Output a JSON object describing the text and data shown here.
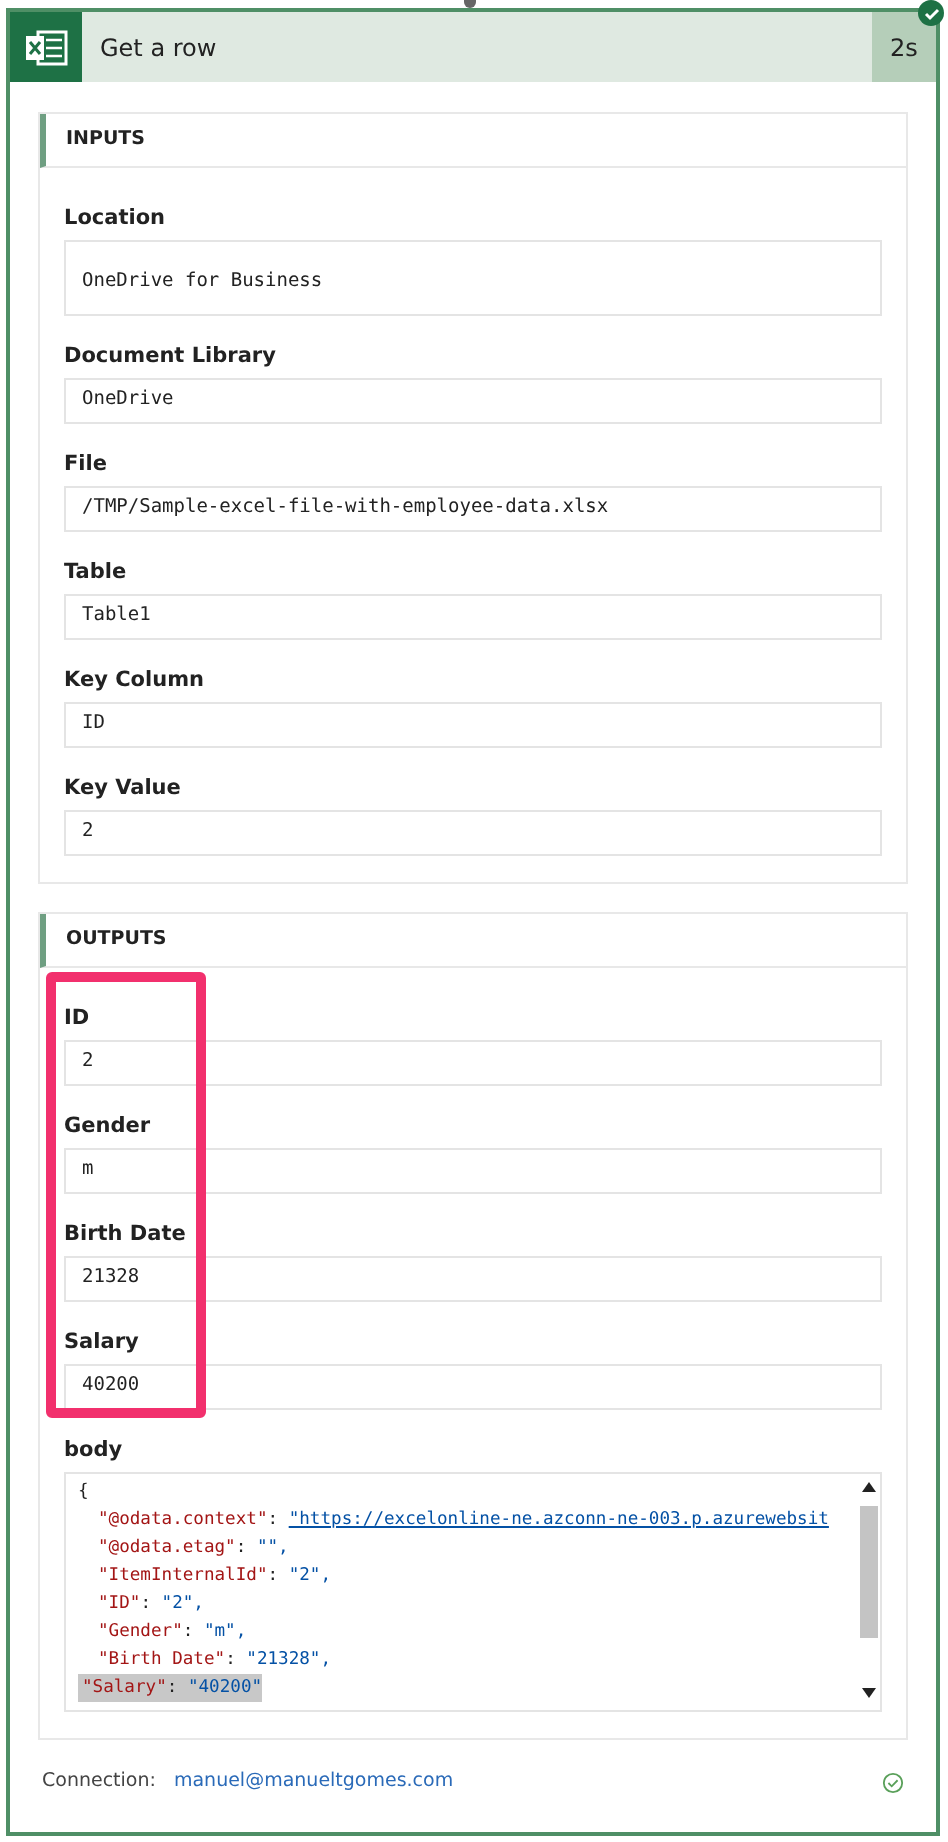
{
  "action": {
    "title": "Get a row",
    "duration": "2s",
    "succeeded": true
  },
  "inputs": {
    "title": "INPUTS",
    "fields": [
      {
        "label": "Location",
        "value": "OneDrive for Business",
        "tall": true
      },
      {
        "label": "Document Library",
        "value": "OneDrive",
        "tall": false
      },
      {
        "label": "File",
        "value": "/TMP/Sample-excel-file-with-employee-data.xlsx",
        "tall": false
      },
      {
        "label": "Table",
        "value": "Table1",
        "tall": false
      },
      {
        "label": "Key Column",
        "value": "ID",
        "tall": false
      },
      {
        "label": "Key Value",
        "value": "2",
        "tall": false
      }
    ]
  },
  "outputs": {
    "title": "OUTPUTS",
    "highlighted": true,
    "fields": [
      {
        "label": "ID",
        "value": "2"
      },
      {
        "label": "Gender",
        "value": "m"
      },
      {
        "label": "Birth Date",
        "value": "21328"
      },
      {
        "label": "Salary",
        "value": "40200"
      }
    ],
    "body": {
      "label": "body",
      "open": "{",
      "lines": [
        {
          "key": "\"@odata.context\"",
          "sep": ":",
          "value": "\"https://excelonline-ne.azconn-ne-003.p.azurewebsit",
          "link": true,
          "selected": false
        },
        {
          "key": "\"@odata.etag\"",
          "sep": ":",
          "value": "\"\",",
          "link": false,
          "selected": false
        },
        {
          "key": "\"ItemInternalId\"",
          "sep": ":",
          "value": "\"2\",",
          "link": false,
          "selected": false
        },
        {
          "key": "\"ID\"",
          "sep": ":",
          "value": "\"2\",",
          "link": false,
          "selected": false
        },
        {
          "key": "\"Gender\"",
          "sep": ":",
          "value": "\"m\",",
          "link": false,
          "selected": false
        },
        {
          "key": "\"Birth Date\"",
          "sep": ":",
          "value": "\"21328\",",
          "link": false,
          "selected": false
        },
        {
          "key": "\"Salary\"",
          "sep": ":",
          "value": "\"40200\"",
          "link": false,
          "selected": true
        }
      ]
    }
  },
  "connection": {
    "label": "Connection:",
    "account": "manuel@manueltgomes.com",
    "ok": true
  }
}
